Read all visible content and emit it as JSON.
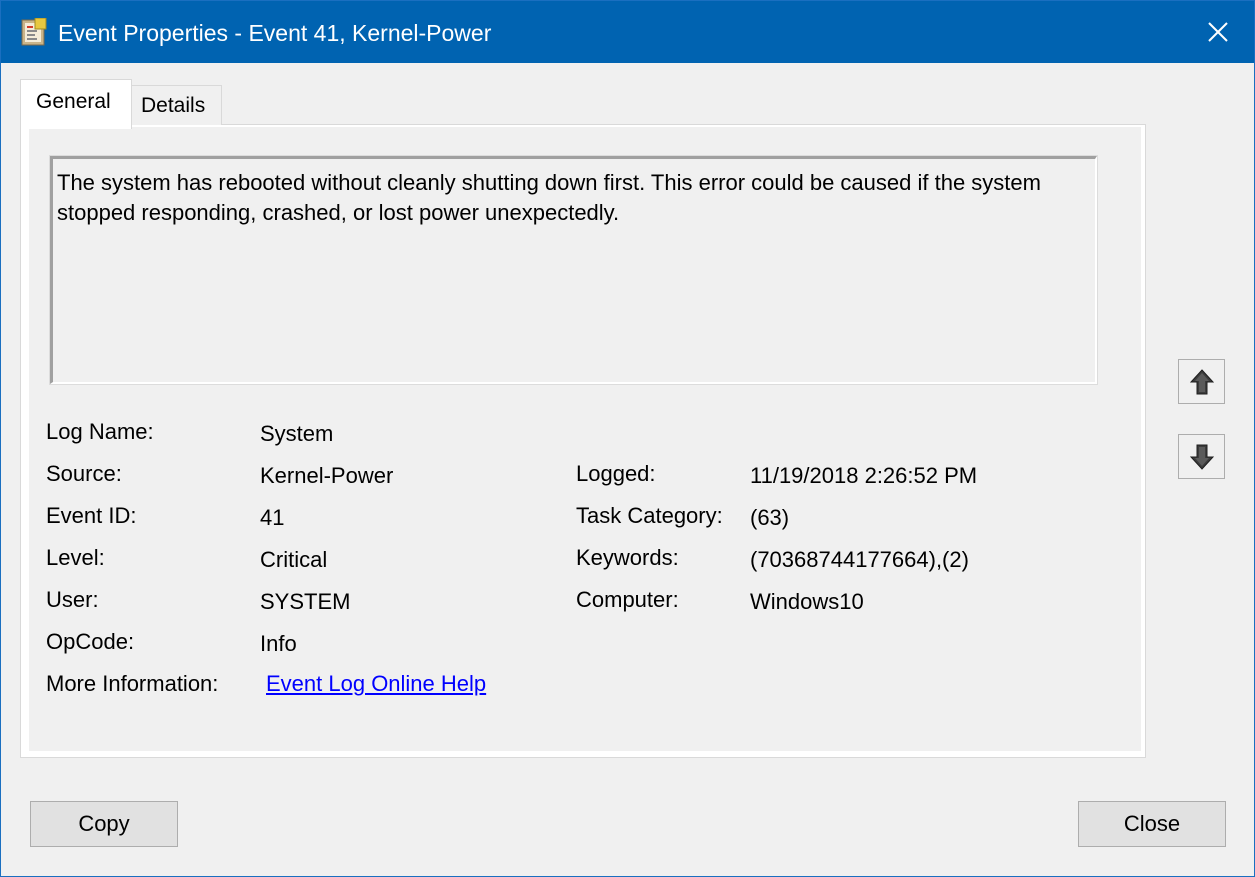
{
  "window": {
    "title": "Event Properties - Event 41, Kernel-Power",
    "accent": "#0063b1"
  },
  "tabs": [
    {
      "label": "General",
      "active": true
    },
    {
      "label": "Details",
      "active": false
    }
  ],
  "description": "The system has rebooted without cleanly shutting down first. This error could be caused if the system stopped responding, crashed, or lost power unexpectedly.",
  "fields": {
    "log_name": {
      "label": "Log Name:",
      "value": "System"
    },
    "source": {
      "label": "Source:",
      "value": "Kernel-Power"
    },
    "event_id": {
      "label": "Event ID:",
      "value": "41"
    },
    "level": {
      "label": "Level:",
      "value": "Critical"
    },
    "user": {
      "label": "User:",
      "value": "SYSTEM"
    },
    "opcode": {
      "label": "OpCode:",
      "value": "Info"
    },
    "more_info": {
      "label": "More Information:",
      "value": "Event Log Online Help"
    },
    "logged": {
      "label": "Logged:",
      "value": "11/19/2018 2:26:52 PM"
    },
    "task_category": {
      "label": "Task Category:",
      "value": "(63)"
    },
    "keywords": {
      "label": "Keywords:",
      "value": "(70368744177664),(2)"
    },
    "computer": {
      "label": "Computer:",
      "value": "Windows10"
    }
  },
  "icons": {
    "title_icon": "event-viewer-icon",
    "close": "close-icon",
    "prev": "arrow-up-icon",
    "next": "arrow-down-icon"
  },
  "buttons": {
    "copy": "Copy",
    "close": "Close"
  }
}
